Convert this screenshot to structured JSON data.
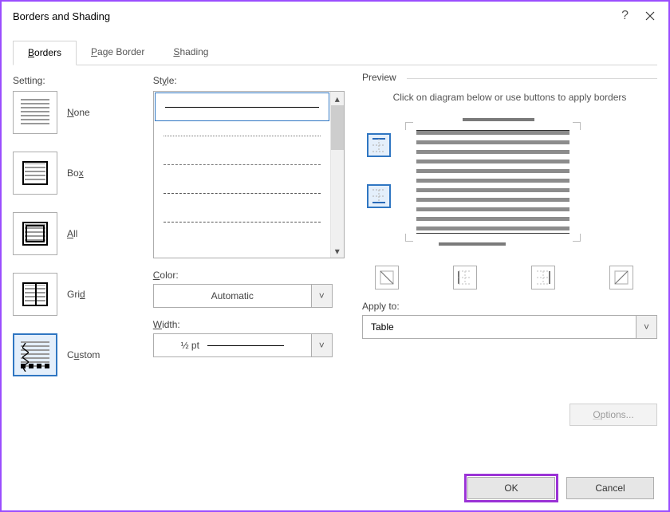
{
  "window": {
    "title": "Borders and Shading"
  },
  "tabs": {
    "borders": "Borders",
    "pageBorder": "Page Border",
    "shading": "Shading"
  },
  "setting": {
    "heading": "Setting:",
    "none": "None",
    "box": "Box",
    "all": "All",
    "grid": "Grid",
    "custom": "Custom"
  },
  "style": {
    "heading": "Style:"
  },
  "color": {
    "heading": "Color:",
    "value": "Automatic"
  },
  "width": {
    "heading": "Width:",
    "value": "½ pt"
  },
  "preview": {
    "heading": "Preview",
    "hint": "Click on diagram below or use buttons to apply borders"
  },
  "applyto": {
    "heading": "Apply to:",
    "value": "Table"
  },
  "buttons": {
    "options": "Options...",
    "ok": "OK",
    "cancel": "Cancel"
  }
}
